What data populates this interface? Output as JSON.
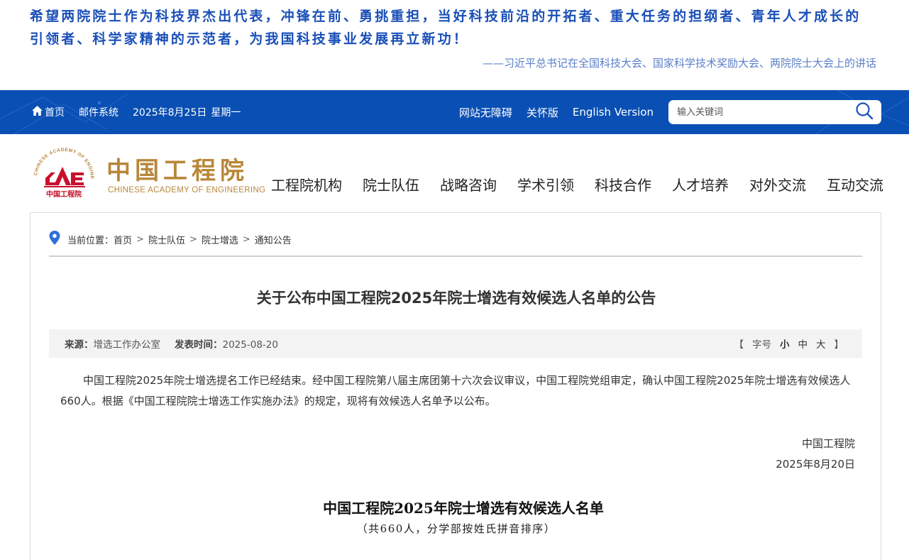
{
  "banner": {
    "quote_line1": "希望两院院士作为科技界杰出代表，冲锋在前、勇挑重担，当好科技前沿的开拓者、重大任务的担纲者、青年人才成长的",
    "quote_line2": "引领者、科学家精神的示范者，为我国科技事业发展再立新功！",
    "source": "——习近平总书记在全国科技大会、国家科学技术奖励大会、两院院士大会上的讲话"
  },
  "topbar": {
    "home_label": "首页",
    "mail_label": "邮件系统",
    "date": "2025年8月25日",
    "weekday": "星期一",
    "accessibility": "网站无障碍",
    "care_mode": "关怀版",
    "english": "English Version",
    "search_placeholder": "输入关键词"
  },
  "logo": {
    "name_cn": "中国工程院",
    "name_en": "CHINESE ACADEMY OF ENGINEERING",
    "seal_ring_text": "CHINESE ACADEMY OF ENGINEERING",
    "seal_letters": "CAE",
    "seal_cn": "中国工程院"
  },
  "nav": {
    "items": [
      "工程院机构",
      "院士队伍",
      "战略咨询",
      "学术引领",
      "科技合作",
      "人才培养",
      "对外交流",
      "互动交流"
    ]
  },
  "breadcrumb": {
    "prefix": "当前位置：",
    "items": [
      "首页",
      "院士队伍",
      "院士增选",
      "通知公告"
    ],
    "separator": ">"
  },
  "article": {
    "title": "关于公布中国工程院2025年院士增选有效候选人名单的公告",
    "source_label": "来源：",
    "source_value": "增选工作办公室",
    "time_label": "发表时间：",
    "time_value": "2025-08-20",
    "font_bracket_open": "【",
    "font_label": "字号",
    "font_small": "小",
    "font_medium": "中",
    "font_large": "大",
    "font_bracket_close": "】",
    "body": "中国工程院2025年院士增选提名工作已经结束。经中国工程院第八届主席团第十六次会议审议，中国工程院党组审定，确认中国工程院2025年院士增选有效候选人660人。根据《中国工程院院士增选工作实施办法》的规定，现将有效候选人名单予以公布。",
    "signature_org": "中国工程院",
    "signature_date": "2025年8月20日",
    "list_title": "中国工程院2025年院士增选有效候选人名单",
    "list_subtitle": "（共660人，分学部按姓氏拼音排序）"
  },
  "colors": {
    "topbar_blue": "#0a4fb3",
    "quote_blue": "#1a4fb8",
    "logo_gold": "#b8873a",
    "logo_red": "#c8102e",
    "location_icon": "#2f6fd8"
  },
  "icons": {
    "home": "home-icon",
    "search": "search-icon",
    "location": "location-pin-icon"
  }
}
